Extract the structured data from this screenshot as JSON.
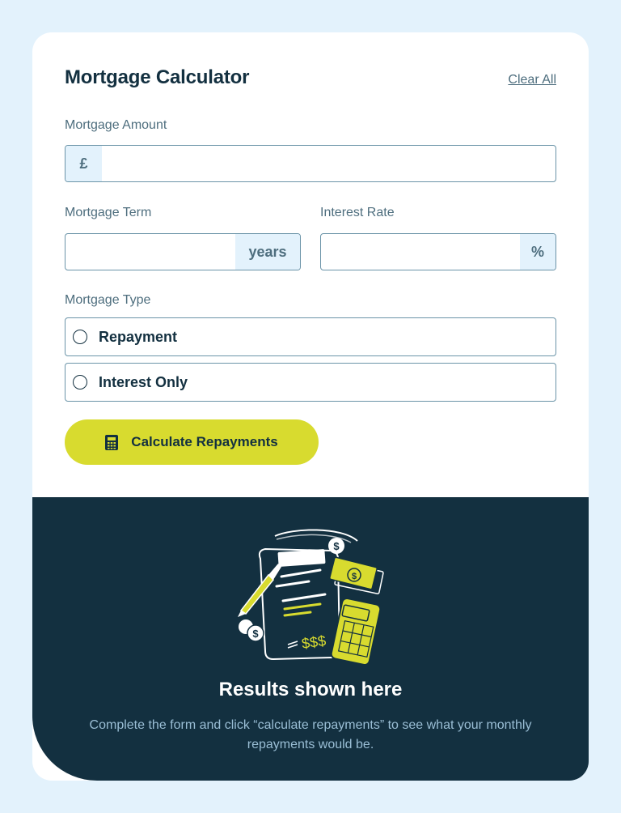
{
  "header": {
    "title": "Mortgage Calculator",
    "clear_label": "Clear All"
  },
  "amount": {
    "label": "Mortgage Amount",
    "prefix": "£",
    "value": ""
  },
  "term": {
    "label": "Mortgage Term",
    "suffix": "years",
    "value": ""
  },
  "rate": {
    "label": "Interest Rate",
    "suffix": "%",
    "value": ""
  },
  "mortgage_type": {
    "label": "Mortgage Type",
    "options": [
      {
        "label": "Repayment",
        "selected": false
      },
      {
        "label": "Interest Only",
        "selected": false
      }
    ]
  },
  "calculate": {
    "label": "Calculate Repayments",
    "icon": "calculator-icon"
  },
  "results": {
    "illustration": "empty-results-illustration",
    "dollar_text": "$$$",
    "title": "Results shown here",
    "description": "Complete the form and click “calculate repayments” to see what your monthly repayments would be."
  },
  "colors": {
    "page_bg": "#e3f2fc",
    "card_bg": "#ffffff",
    "dark": "#133040",
    "slate": "#4e6e7e",
    "border": "#6b94a8",
    "lime": "#d8db2f",
    "addon_bg": "#e3f2fc"
  }
}
